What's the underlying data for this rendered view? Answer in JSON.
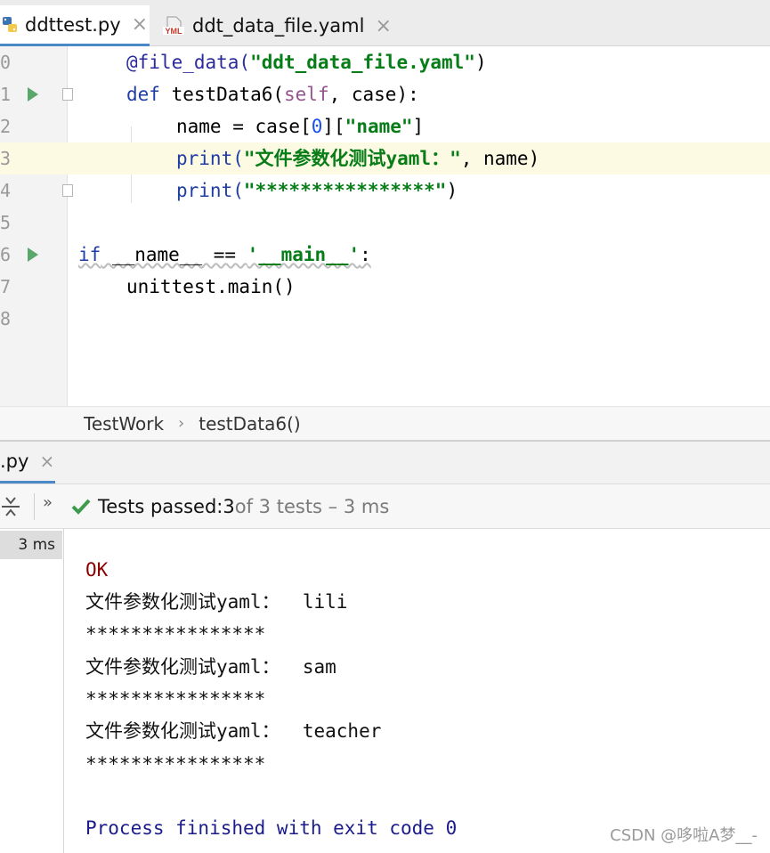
{
  "tabs": [
    {
      "label": "ddttest.py",
      "active": true,
      "icon": "python-file-icon"
    },
    {
      "label": "ddt_data_file.yaml",
      "active": false,
      "icon": "yaml-file-icon",
      "icon_text": "YML"
    }
  ],
  "editor": {
    "line_numbers": [
      "0",
      "1",
      "2",
      "3",
      "4",
      "5",
      "6",
      "7",
      "8"
    ],
    "lines": {
      "l0": {
        "a": "@file_data(",
        "b": "\"ddt_data_file.yaml\"",
        "c": ")"
      },
      "l1": {
        "kw": "def",
        "a": " testData6(",
        "self": "self",
        "b": ", case):"
      },
      "l2": {
        "a": "name = case[",
        "num": "0",
        "b": "][",
        "str": "\"name\"",
        "c": "]"
      },
      "l3": {
        "a": "print(",
        "str": "\"文件参数化测试yaml：\"",
        "b": ", name)"
      },
      "l4": {
        "a": "print(",
        "str": "\"****************\"",
        "b": ")"
      },
      "l6": {
        "kw": "if",
        "a": " __name__ == ",
        "str": "'__main__'",
        "b": ":"
      },
      "l7": {
        "a": "unittest.main()"
      }
    }
  },
  "breadcrumb": [
    "TestWork",
    "testData6()"
  ],
  "run_tab": {
    "label": ".py"
  },
  "toolbar": {
    "more": "»",
    "status_prefix": "Tests passed: ",
    "passed_count": "3",
    "status_suffix": " of 3 tests – 3 ms"
  },
  "tree": {
    "time": "3 ms"
  },
  "console": {
    "lines": [
      "OK",
      "文件参数化测试yaml：  lili",
      "****************",
      "文件参数化测试yaml：  sam",
      "****************",
      "文件参数化测试yaml：  teacher",
      "****************",
      "",
      "Process finished with exit code 0"
    ]
  },
  "watermark": "CSDN @哆啦A梦__-",
  "colors": {
    "accent": "#4a88c7",
    "run_green": "#59a869",
    "string": "#067d17",
    "keyword": "#1f3ea5",
    "ok_red": "#8b0000"
  }
}
